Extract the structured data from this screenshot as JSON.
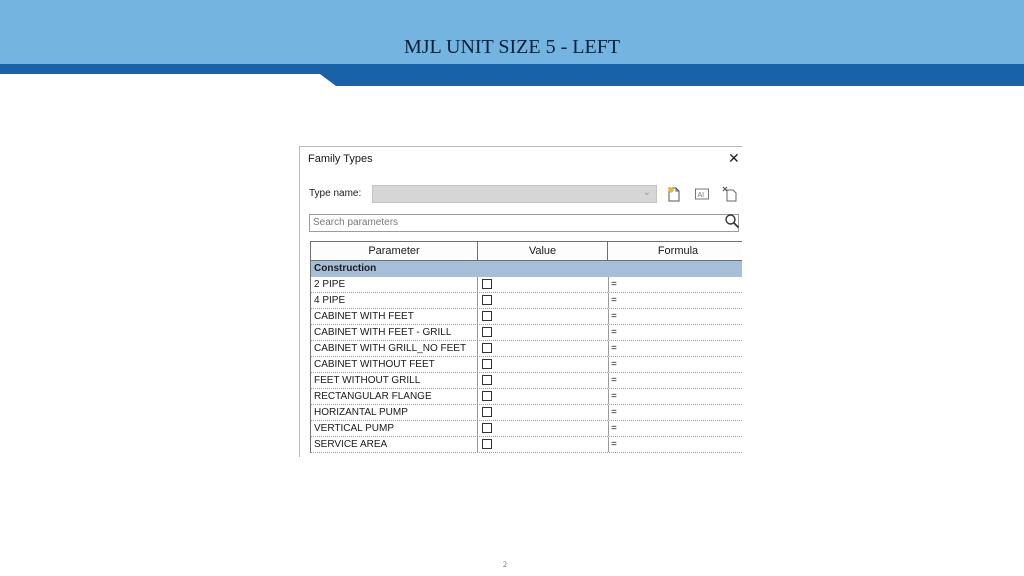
{
  "slide": {
    "title": "MJL UNIT SIZE 5 - LEFT",
    "page_number": "2",
    "colors": {
      "header_light": "#74b4e0",
      "header_dark": "#1762a8"
    }
  },
  "dialog": {
    "title": "Family Types",
    "close_glyph": "✕",
    "type_name_label": "Type name:",
    "type_name_value": "",
    "search_placeholder": "Search parameters",
    "columns": {
      "parameter": "Parameter",
      "value": "Value",
      "formula": "Formula"
    },
    "group": "Construction",
    "rows": [
      {
        "name": "2 PIPE",
        "checked": false,
        "formula": "="
      },
      {
        "name": "4 PIPE",
        "checked": false,
        "formula": "="
      },
      {
        "name": "CABINET WITH FEET",
        "checked": false,
        "formula": "="
      },
      {
        "name": "CABINET WITH FEET - GRILL",
        "checked": false,
        "formula": "="
      },
      {
        "name": "CABINET WITH GRILL_NO FEET",
        "checked": false,
        "formula": "="
      },
      {
        "name": "CABINET WITHOUT FEET",
        "checked": false,
        "formula": "="
      },
      {
        "name": "FEET WITHOUT GRILL",
        "checked": false,
        "formula": "="
      },
      {
        "name": "RECTANGULAR FLANGE",
        "checked": false,
        "formula": "="
      },
      {
        "name": "HORIZANTAL PUMP",
        "checked": false,
        "formula": "="
      },
      {
        "name": "VERTICAL PUMP",
        "checked": false,
        "formula": "="
      },
      {
        "name": "SERVICE AREA",
        "checked": false,
        "formula": "="
      }
    ],
    "icons": [
      "new-type-icon",
      "rename-type-icon",
      "delete-type-icon",
      "search-icon",
      "chevron-down-icon"
    ],
    "colors": {
      "group_row": "#a6bfd9",
      "select_bg": "#d6d6d6"
    }
  }
}
